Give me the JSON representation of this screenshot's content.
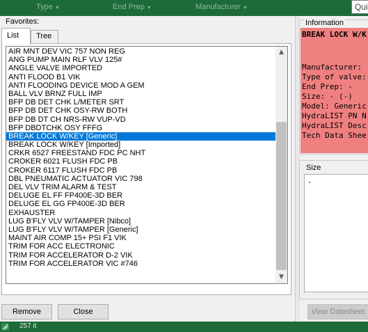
{
  "header": {
    "columns": [
      "Type",
      "End Prep",
      "Manufacturer"
    ],
    "quick_search": "Qui"
  },
  "favorites": {
    "label": "Favorites:",
    "tabs": [
      "List",
      "Tree"
    ],
    "items": [
      "AIR MNT DEV VIC 757 NON REG",
      "ANG PUMP MAIN RLF VLV 125#",
      "ANGLE VALVE IMPORTED",
      "ANTI FLOOD B1 VIK",
      "ANTI FLOODING DEVICE MOD A GEM",
      "BALL VLV BRNZ FULL IMP",
      "BFP DB DET CHK L/METER SRT",
      "BFP DB DET CHK OSY-RW BOTH",
      "BFP DB DT CH NRS-RW VUP-VD",
      "BFP DBDTCHK OSY FFFG",
      "BREAK LOCK W/KEY [Generic]",
      "BREAK LOCK W/KEY [Imported]",
      "CRKR 6527 FREESTAND FDC PC NHT",
      "CROKER 6021 FLUSH FDC PB",
      "CROKER 6117 FLUSH FDC PB",
      "DBL PNEUMATIC ACTUATOR VIC 798",
      "DEL VLV TRIM ALARM & TEST",
      "DELUGE EL FF FP400E-3D BER",
      "DELUGE EL GG FP400E-3D BER",
      "EXHAUSTER",
      "LUG B'FLY VLV W/TAMPER [Nibco]",
      "LUG B'FLY VLV W/TAMPER [Generic]",
      "MAINT AIR COMP 15+ PSI F1 VIK",
      "TRIM FOR ACC ELECTRONIC",
      "TRIM FOR ACCELERATOR D-2 VIK",
      "TRIM FOR ACCELERATOR VIC #746"
    ],
    "selected_index": 10
  },
  "buttons": {
    "remove": "Remove",
    "close": "Close",
    "view_datasheet": "View Datasheet"
  },
  "information": {
    "title": "Information",
    "heading": "BREAK LOCK W/K",
    "lines": [
      "Manufacturer:",
      "Type of valve:",
      "End Prep: -",
      "Size: - (-)",
      "Model: Generic",
      "HydraLIST PN N",
      "HydraLIST Desc",
      "Tech Data Shee"
    ],
    "background_color": "#f08080"
  },
  "size": {
    "title": "Size",
    "value": "-"
  },
  "status": {
    "text": "257 it"
  },
  "colors": {
    "toolbar_green": "#1e6b3a",
    "selection_blue": "#0078d7"
  }
}
